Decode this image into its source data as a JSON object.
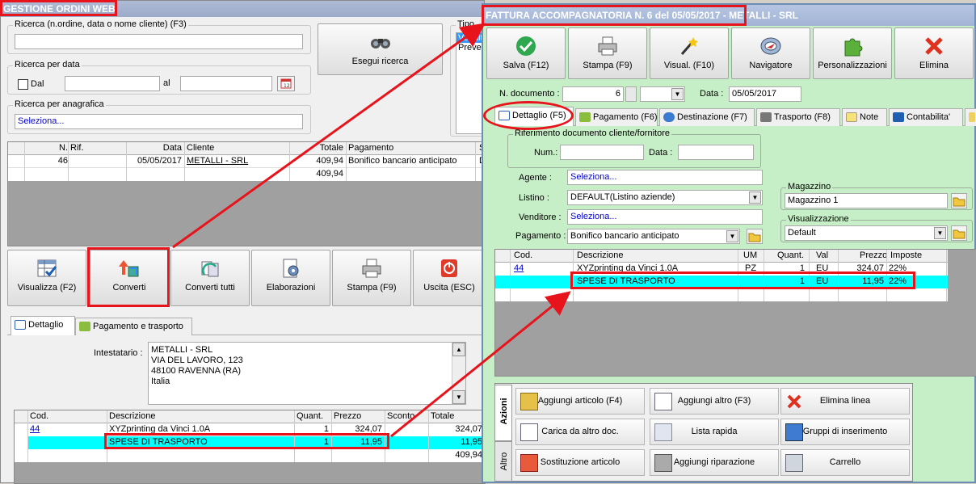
{
  "left": {
    "title": "GESTIONE ORDINI WEB",
    "ricerca_label": "Ricerca (n.ordine, data o nome cliente) (F3)",
    "ricerca_data_label": "Ricerca per data",
    "dal_label": "Dal",
    "al_label": "al",
    "ricerca_anagrafica_label": "Ricerca per anagrafica",
    "seleziona": "Seleziona...",
    "esegui_ricerca": "Esegui ricerca",
    "tipo_label": "Tipo",
    "tipo_items": [
      "Vendit",
      "Preven"
    ],
    "orders_headers": [
      "N.",
      "Rif.",
      "Data",
      "Cliente",
      "Totale",
      "Pagamento",
      "S"
    ],
    "orders_row": {
      "n": "46",
      "rif": "",
      "data": "05/05/2017",
      "cliente": "METALLI - SRL",
      "totale": "409,94",
      "pagamento": "Bonifico bancario anticipato",
      "s": "D"
    },
    "orders_total": "409,94",
    "toolbar": [
      "Visualizza (F2)",
      "Converti",
      "Converti tutti",
      "Elaborazioni",
      "Stampa (F9)",
      "Uscita (ESC)"
    ],
    "tabs": [
      "Dettaglio",
      "Pagamento e trasporto"
    ],
    "intestatario_label": "Intestatario :",
    "intestatario_lines": [
      "METALLI - SRL",
      "VIA DEL LAVORO, 123",
      "48100 RAVENNA (RA)",
      "Italia"
    ],
    "detail_headers": [
      "Cod.",
      "Descrizione",
      "Quant.",
      "Prezzo",
      "Sconto",
      "Totale"
    ],
    "detail_rows": [
      {
        "cod": "44",
        "desc": "XYZprinting da Vinci 1.0A",
        "quant": "1",
        "prezzo": "324,07",
        "sconto": "",
        "totale": "324,07"
      },
      {
        "cod": "",
        "desc": "SPESE DI TRASPORTO",
        "quant": "1",
        "prezzo": "11,95",
        "sconto": "",
        "totale": "11,95"
      }
    ],
    "detail_total": "409,94"
  },
  "right": {
    "title_boxed": "FATTURA ACCOMPAGNATORIA N. 6 del 05/05/2017",
    "title_rest": " - METALLI - SRL",
    "toolbar": [
      "Salva (F12)",
      "Stampa (F9)",
      "Visual. (F10)",
      "Navigatore",
      "Personalizzazioni",
      "Elimina"
    ],
    "ndoc_label": "N. documento :",
    "ndoc_value": "6",
    "data_label": "Data :",
    "data_value": "05/05/2017",
    "tabs": [
      "Dettaglio (F5)",
      "Pagamento (F6)",
      "Destinazione (F7)",
      "Trasporto (F8)",
      "Note",
      "Contabilita'"
    ],
    "rif_label": "Riferimento documento cliente/fornitore",
    "num_label": "Num.:",
    "rdata_label": "Data :",
    "agente_label": "Agente :",
    "agente_value": "Seleziona...",
    "listino_label": "Listino :",
    "listino_value": "DEFAULT(Listino aziende)",
    "venditore_label": "Venditore :",
    "venditore_value": "Seleziona...",
    "pagamento_label": "Pagamento :",
    "pagamento_value": "Bonifico bancario anticipato",
    "magazzino_label": "Magazzino",
    "magazzino_value": "Magazzino 1",
    "visual_label": "Visualizzazione",
    "visual_value": "Default",
    "grid_headers": [
      "Cod.",
      "Descrizione",
      "UM",
      "Quant.",
      "Val",
      "Prezzo",
      "Imposte"
    ],
    "grid_rows": [
      {
        "cod": "44",
        "desc": "XYZprinting da Vinci 1.0A",
        "um": "PZ",
        "quant": "1",
        "val": "EU",
        "prezzo": "324,07",
        "imposte": "22%"
      },
      {
        "cod": "",
        "desc": "SPESE DI TRASPORTO",
        "um": "",
        "quant": "1",
        "val": "EU",
        "prezzo": "11,95",
        "imposte": "22%"
      }
    ],
    "side_tabs": [
      "Azioni",
      "Altro"
    ],
    "actions": [
      "Aggiungi articolo (F4)",
      "Aggiungi altro (F3)",
      "Elimina linea",
      "Carica da altro doc.",
      "Lista rapida",
      "Gruppi di inserimento",
      "Sostituzione articolo",
      "Aggiungi riparazione",
      "Carrello"
    ]
  }
}
